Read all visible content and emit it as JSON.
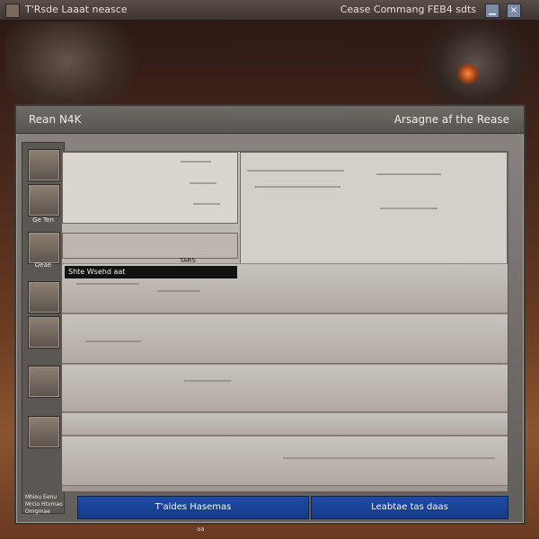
{
  "top_bar": {
    "title_left": "T'Rsde Laaat neasce",
    "title_right": "Cease Commang FEB4 sdts"
  },
  "panel": {
    "title_left": "Rean N4K",
    "title_right": "Arsagne af the Rease"
  },
  "side_labels": {
    "first": "Ge Ten",
    "second": "Oeae",
    "footer": "Mhiou Eenu\nMrcio\nHtxmao\nOnrgmae"
  },
  "highlighted_entry": "Shte Wsehd aat",
  "dropdown_hint": "TARS",
  "buttons": {
    "left": "T'aldes Hasemas",
    "right": "Leabtae tas daas"
  },
  "bottom_mark": "aa"
}
